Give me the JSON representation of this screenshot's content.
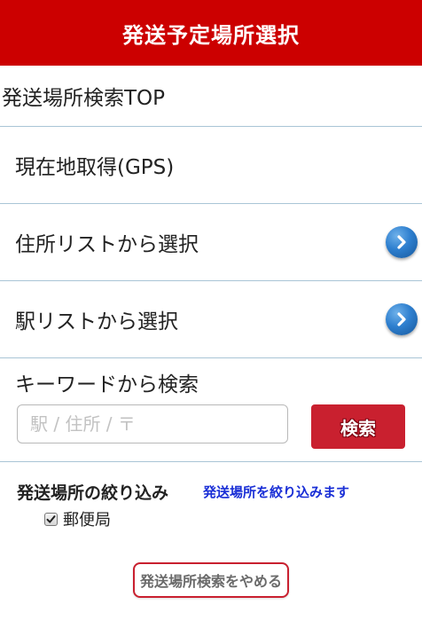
{
  "header": {
    "title": "発送予定場所選択"
  },
  "menu": {
    "top_label": "発送場所検索TOP",
    "gps_label": "現在地取得(GPS)",
    "address_list_label": "住所リストから選択",
    "station_list_label": "駅リストから選択"
  },
  "keyword": {
    "title": "キーワードから検索",
    "placeholder": "駅 / 住所 / 〒",
    "value": "",
    "search_button": "検索"
  },
  "filter": {
    "title": "発送場所の絞り込み",
    "link": "発送場所を絞り込みます",
    "post_office_label": "郵便局",
    "post_office_checked": true
  },
  "footer": {
    "cancel_button": "発送場所検索をやめる"
  },
  "colors": {
    "header_bg": "#cc0000",
    "button_red": "#c9202f",
    "divider": "#a9c5d6",
    "link_blue": "#1a2fd6",
    "arrow_blue": "#2e7fcf"
  }
}
